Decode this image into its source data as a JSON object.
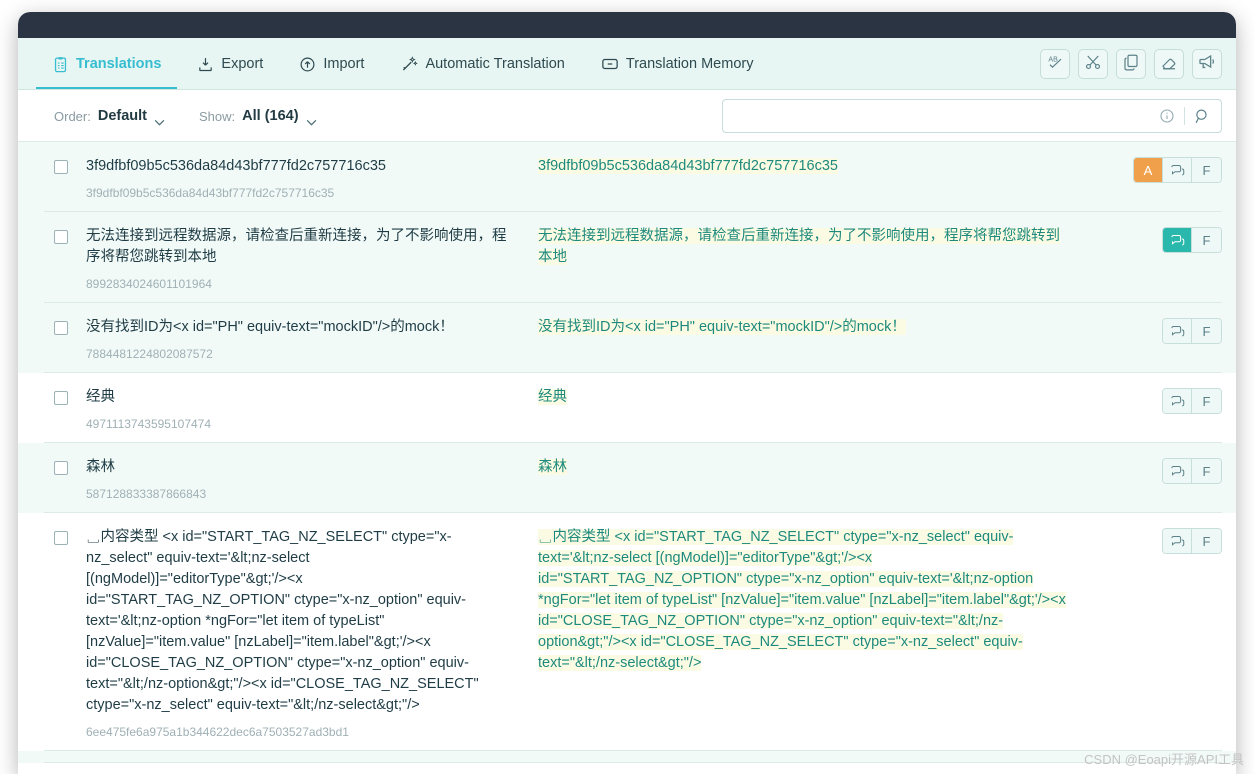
{
  "nav": {
    "tabs": [
      {
        "label": "Translations",
        "icon": "clipboard-list-icon",
        "active": true
      },
      {
        "label": "Export",
        "icon": "export-download-icon",
        "active": false
      },
      {
        "label": "Import",
        "icon": "import-upload-icon",
        "active": false
      },
      {
        "label": "Automatic Translation",
        "icon": "magic-wand-icon",
        "active": false
      },
      {
        "label": "Translation Memory",
        "icon": "archive-drawer-icon",
        "active": false
      }
    ],
    "actions": [
      {
        "name": "spellcheck-icon",
        "title": "AB"
      },
      {
        "name": "scissors-icon",
        "title": ""
      },
      {
        "name": "copy-icon",
        "title": ""
      },
      {
        "name": "eraser-icon",
        "title": ""
      },
      {
        "name": "megaphone-icon",
        "title": ""
      }
    ]
  },
  "filters": {
    "order_label": "Order:",
    "order_value": "Default",
    "show_label": "Show:",
    "show_value": "All (164)"
  },
  "search": {
    "value": "",
    "placeholder": ""
  },
  "rows": [
    {
      "source": "3f9dfbf09b5c536da84d43bf777fd2c757716c35",
      "id": "3f9dfbf09b5c536da84d43bf777fd2c757716c35",
      "target": "3f9dfbf09b5c536da84d43bf777fd2c757716c35",
      "badge": "A",
      "comment": "F"
    },
    {
      "source": "无法连接到远程数据源，请检查后重新连接，为了不影响使用，程序将帮您跳转到本地",
      "id": "8992834024601101964",
      "target": "无法连接到远程数据源，请检查后重新连接，为了不影响使用，程序将帮您跳转到本地",
      "badge": "",
      "comment": "F"
    },
    {
      "source": "没有找到ID为<x id=\"PH\" equiv-text=\"mockID\"/>的mock！",
      "id": "7884481224802087572",
      "target": "没有找到ID为<x id=\"PH\" equiv-text=\"mockID\"/>的mock！",
      "badge": "",
      "comment": "F"
    },
    {
      "source": "经典",
      "id": "4971113743595107474",
      "target": "经典",
      "badge": "",
      "comment": "F"
    },
    {
      "source": "森林",
      "id": "587128833387866843",
      "target": "森林",
      "badge": "",
      "comment": "F"
    },
    {
      "source": "␣内容类型 <x id=\"START_TAG_NZ_SELECT\" ctype=\"x-nz_select\" equiv-text='&lt;nz-select [(ngModel)]=\"editorType\"&gt;'/><x id=\"START_TAG_NZ_OPTION\" ctype=\"x-nz_option\" equiv-text='&lt;nz-option *ngFor=\"let item of typeList\" [nzValue]=\"item.value\" [nzLabel]=\"item.label\"&gt;'/><x id=\"CLOSE_TAG_NZ_OPTION\" ctype=\"x-nz_option\" equiv-text=\"&lt;/nz-option&gt;\"/><x id=\"CLOSE_TAG_NZ_SELECT\" ctype=\"x-nz_select\" equiv-text=\"&lt;/nz-select&gt;\"/>",
      "id": "6ee475fe6a975a1b344622dec6a7503527ad3bd1",
      "target": "␣内容类型 <x id=\"START_TAG_NZ_SELECT\" ctype=\"x-nz_select\" equiv-text='&lt;nz-select [(ngModel)]=\"editorType\"&gt;'/><x id=\"START_TAG_NZ_OPTION\" ctype=\"x-nz_option\" equiv-text='&lt;nz-option *ngFor=\"let item of typeList\" [nzValue]=\"item.value\" [nzLabel]=\"item.label\"&gt;'/><x id=\"CLOSE_TAG_NZ_OPTION\" ctype=\"x-nz_option\" equiv-text=\"&lt;/nz-option&gt;\"/><x id=\"CLOSE_TAG_NZ_SELECT\" ctype=\"x-nz_select\" equiv-text=\"&lt;/nz-select&gt;\"/>",
      "badge": "",
      "comment": "F"
    }
  ],
  "watermark": "CSDN @Eoapi开源API工具",
  "colors": {
    "accent": "#36bdd0",
    "nav_bg": "#e8f6f3",
    "target_text": "#1e8a7d",
    "target_highlight": "#fbfbe4",
    "badge_orange": "#f0a04b",
    "badge_teal": "#2ab8ad",
    "titlebar": "#2b3442"
  }
}
